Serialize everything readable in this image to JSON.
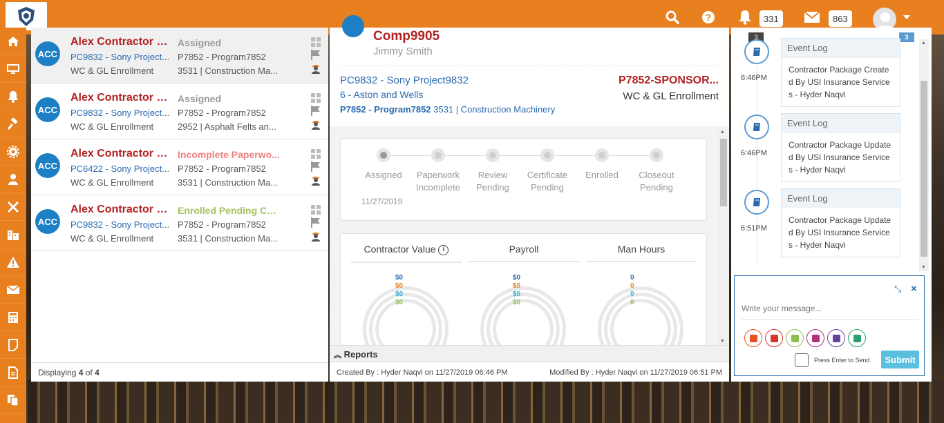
{
  "topbar": {
    "notifications_count": "331",
    "messages_count": "863"
  },
  "sidebar": {
    "items": [
      "home-icon",
      "monitor-icon",
      "bell-icon",
      "gavel-icon",
      "gear-icon",
      "user-icon",
      "tools-icon",
      "building-icon",
      "warning-icon",
      "envelope-icon",
      "calculator-icon",
      "note-icon",
      "file-icon",
      "copy-icon"
    ]
  },
  "list": {
    "cards": [
      {
        "avatar": "ACC",
        "title": "Alex Contractor Co...",
        "status": "Assigned",
        "status_color": "#999999",
        "project": "PC9832 - Sony Project...",
        "program": "P7852 - Program7852",
        "type": "WC & GL Enrollment",
        "code": "3531 | Construction Ma..."
      },
      {
        "avatar": "ACC",
        "title": "Alex Contractor Co...",
        "status": "Assigned",
        "status_color": "#999999",
        "project": "PC9832 - Sony Project...",
        "program": "P7852 - Program7852",
        "type": "WC & GL Enrollment",
        "code": "2952 | Asphalt Felts an..."
      },
      {
        "avatar": "ACC",
        "title": "Alex Contractor Co...",
        "status": "Incomplete Paperwo...",
        "status_color": "#f08080",
        "project": "PC6422 - Sony Project...",
        "program": "P7852 - Program7852",
        "type": "WC & GL Enrollment",
        "code": "3531 | Construction Ma..."
      },
      {
        "avatar": "ACC",
        "title": "Alex Contractor Co...",
        "status": "Enrolled Pending Cer...",
        "status_color": "#a5c261",
        "project": "PC9832 - Sony Project...",
        "program": "P7852 - Program7852",
        "type": "WC & GL Enrollment",
        "code": "3531 | Construction Ma..."
      }
    ],
    "footer": {
      "prefix": "Displaying ",
      "shown": "4",
      "of": " of ",
      "total": "4"
    }
  },
  "detail": {
    "company": "Comp9905",
    "contact": "Jimmy Smith",
    "project": "PC9832 - Sony Project9832",
    "association": "6 - Aston and Wells",
    "program_code": "P7852 - Program7852",
    "class_code": "3531 | Construction Machinery",
    "sponsor": "P7852-SPONSOR...",
    "enrollment": "WC & GL Enrollment",
    "steps": [
      {
        "label1": "Assigned",
        "label2": "",
        "active": true
      },
      {
        "label1": "Paperwork",
        "label2": "Incomplete",
        "active": false
      },
      {
        "label1": "Review",
        "label2": "Pending",
        "active": false
      },
      {
        "label1": "Certificate",
        "label2": "Pending",
        "active": false
      },
      {
        "label1": "Enrolled",
        "label2": "",
        "active": false
      },
      {
        "label1": "Closeout",
        "label2": "Pending",
        "active": false
      }
    ],
    "step_date": "11/27/2019",
    "charts": [
      {
        "title": "Contractor Value",
        "values": [
          "$0",
          "$0",
          "$0",
          "$0"
        ]
      },
      {
        "title": "Payroll",
        "values": [
          "$0",
          "$0",
          "$0",
          "$0"
        ]
      },
      {
        "title": "Man Hours",
        "values": [
          "0",
          "0",
          "0",
          "0"
        ]
      }
    ],
    "chart_colors": [
      "#2a6bb0",
      "#e8801f",
      "#31b0d5",
      "#8cc152"
    ],
    "reports_label": "Reports",
    "created": "Created By : Hyder Naqvi on 11/27/2019 06:46 PM",
    "modified": "Modified By : Hyder Naqvi on 11/27/2019 06:51 PM"
  },
  "timeline": {
    "top_badge_left": "3",
    "top_badge_right": "3",
    "events": [
      {
        "time": "6:46PM",
        "title": "Event Log",
        "body": "Contractor Package Created By USI Insurance Services - Hyder Naqvi"
      },
      {
        "time": "6:46PM",
        "title": "Event Log",
        "body": "Contractor Package Updated By USI Insurance Services - Hyder Naqvi"
      },
      {
        "time": "6:51PM",
        "title": "Event Log",
        "body": "Contractor Package Updated By USI Insurance Services - Hyder Naqvi"
      }
    ]
  },
  "message": {
    "placeholder": "Write your message...",
    "enter_label": "Press Enter to Send",
    "submit_label": "Submit",
    "attach_colors": [
      "#e8501f",
      "#d9342b",
      "#8cc152",
      "#b0307a",
      "#6a3fa0",
      "#2aa16a"
    ]
  }
}
